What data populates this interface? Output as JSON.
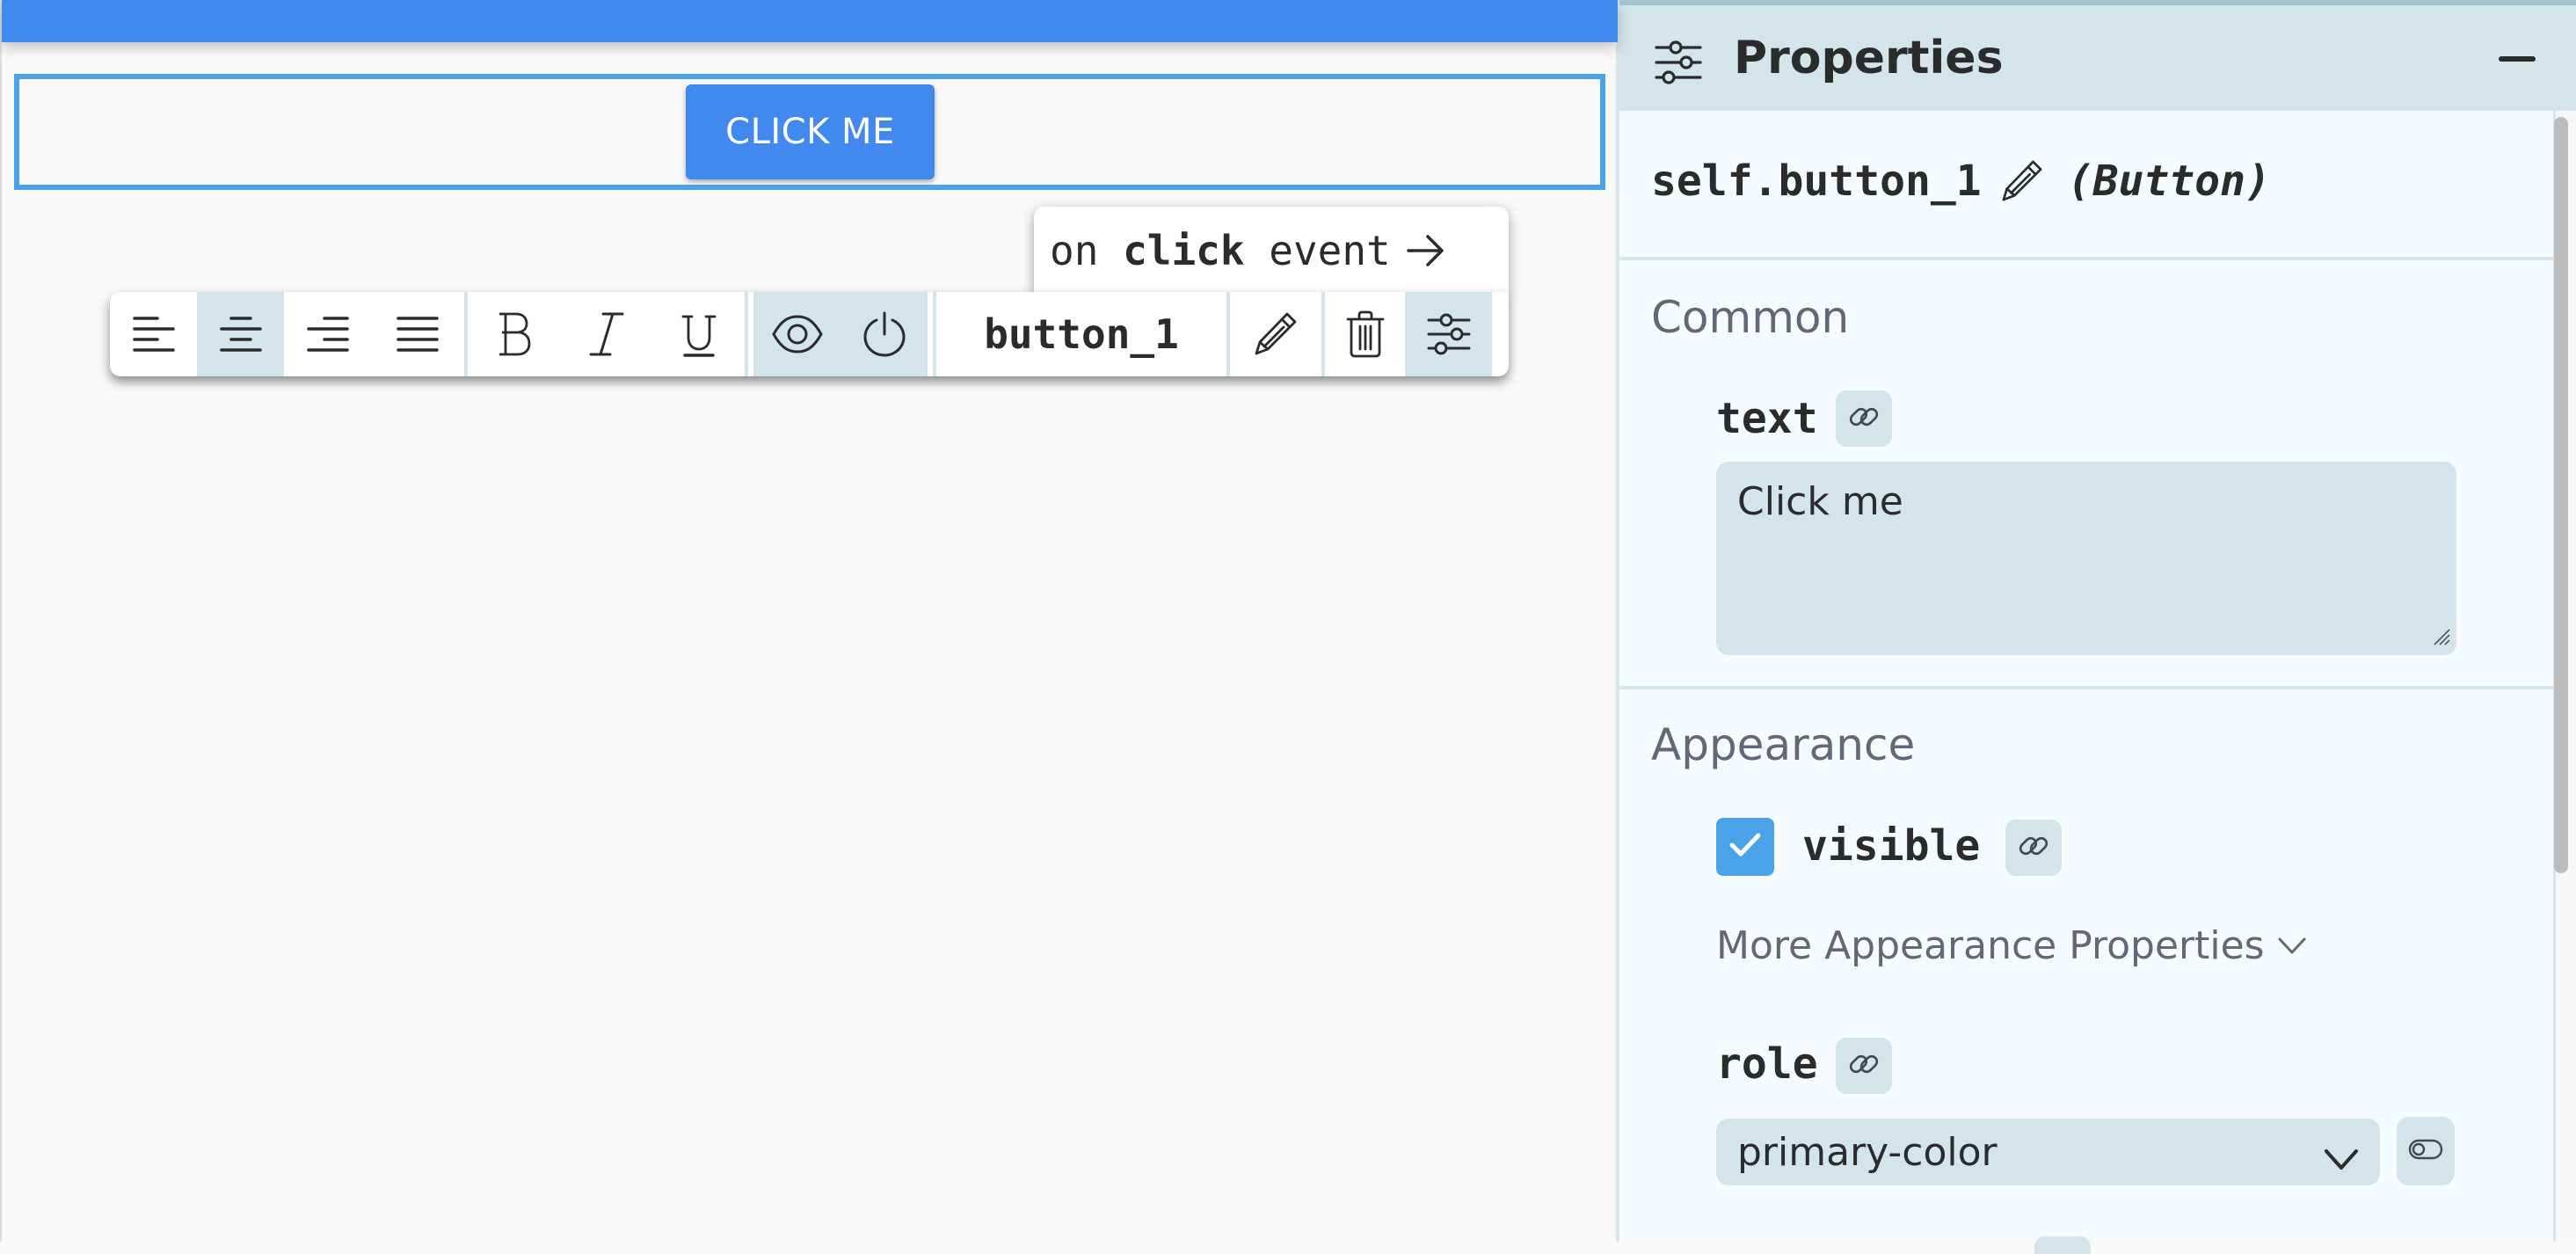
{
  "canvas": {
    "button_text": "CLICK ME",
    "colors": {
      "topbar": "#4189ee",
      "selection_border": "#4aa3e8",
      "button_bg": "#4189ee"
    }
  },
  "event_popover": {
    "prefix": "on",
    "event_name": "click",
    "suffix": "event",
    "icon": "arrow-right-icon"
  },
  "toolbar": {
    "align_buttons": [
      {
        "name": "align-left",
        "icon": "align-left-icon",
        "active": false
      },
      {
        "name": "align-center",
        "icon": "align-center-icon",
        "active": true
      },
      {
        "name": "align-right",
        "icon": "align-right-icon",
        "active": false
      },
      {
        "name": "align-justify",
        "icon": "align-justify-icon",
        "active": false
      }
    ],
    "format_buttons": [
      {
        "name": "bold",
        "icon": "bold-icon",
        "label": "B"
      },
      {
        "name": "italic",
        "icon": "italic-icon",
        "label": "I"
      },
      {
        "name": "underline",
        "icon": "underline-icon",
        "label": "U"
      }
    ],
    "state_buttons": [
      {
        "name": "visible",
        "icon": "eye-icon",
        "active": true
      },
      {
        "name": "enabled",
        "icon": "power-icon",
        "active": true
      }
    ],
    "component_name": "button_1",
    "action_buttons": [
      {
        "name": "rename",
        "icon": "pencil-icon"
      },
      {
        "name": "delete",
        "icon": "trash-icon"
      },
      {
        "name": "properties",
        "icon": "sliders-icon",
        "active": true
      }
    ]
  },
  "panel": {
    "title": "Properties",
    "header_icon": "sliders-icon",
    "minimize_icon": "minus-icon",
    "object_name": "self.button_1",
    "object_type": "(Button)",
    "sections": {
      "common": {
        "heading": "Common",
        "text_label": "text",
        "text_value": "Click me"
      },
      "appearance": {
        "heading": "Appearance",
        "visible_label": "visible",
        "visible_checked": true,
        "more_label": "More Appearance Properties",
        "role_label": "role",
        "role_value": "primary-color"
      }
    },
    "colors": {
      "header_bg": "#d3e4eb",
      "body_bg": "#f5fbfe",
      "section_heading": "#636776",
      "checkbox": "#4aa3e8"
    }
  }
}
